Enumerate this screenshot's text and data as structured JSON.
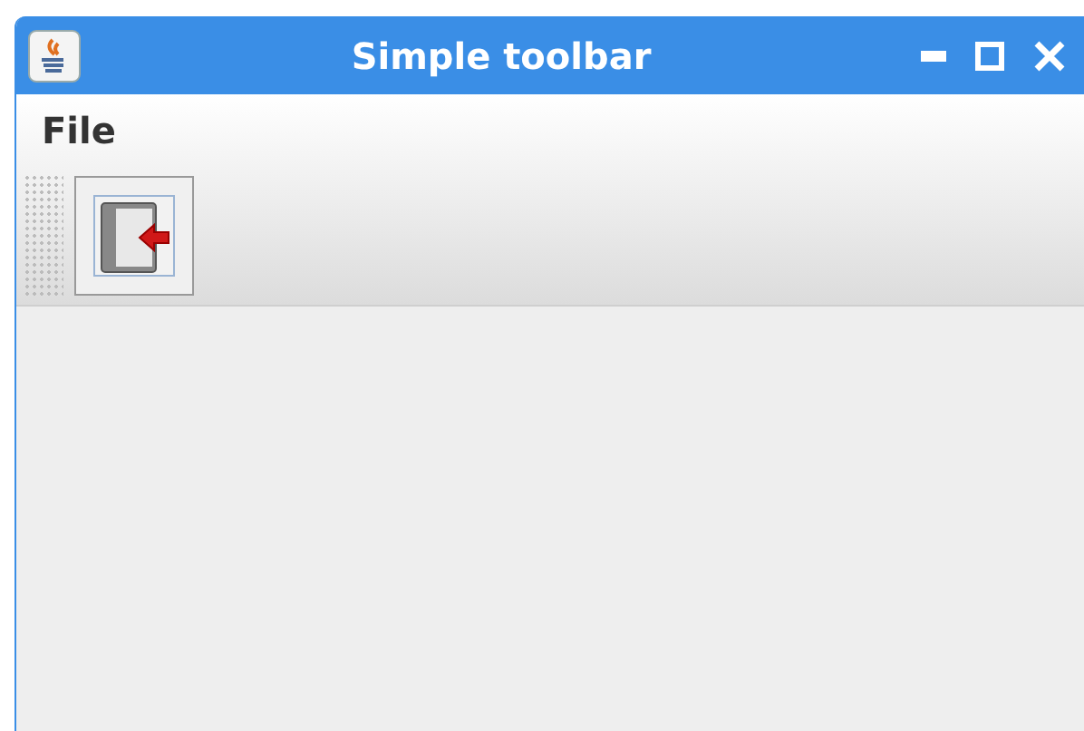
{
  "window": {
    "title": "Simple toolbar"
  },
  "menu": [
    "File"
  ]
}
